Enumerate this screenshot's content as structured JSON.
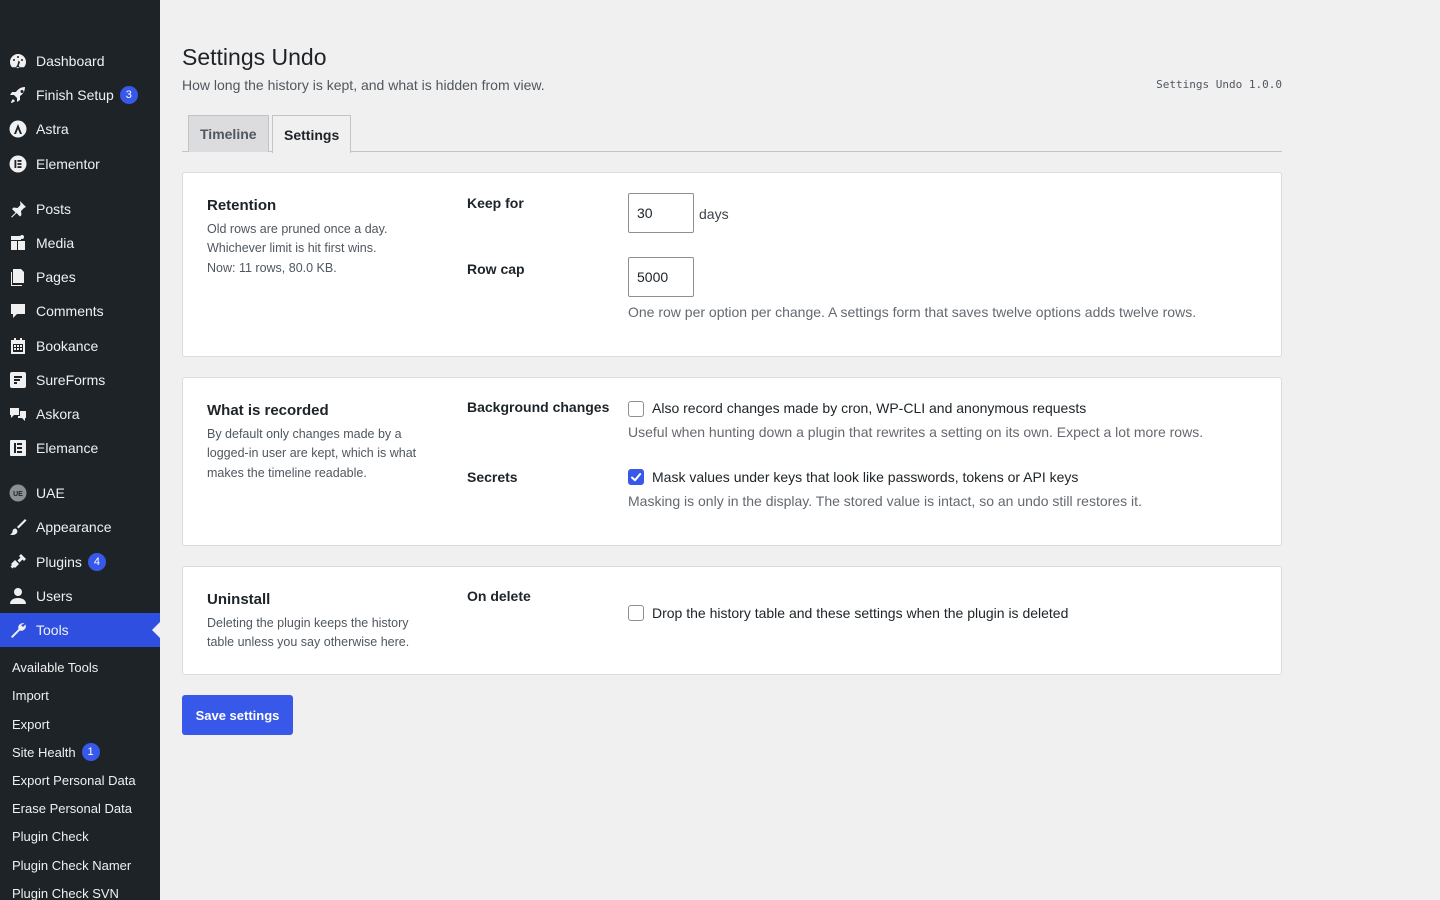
{
  "sidebar": {
    "items": [
      {
        "label": "Dashboard",
        "icon": "dashboard-icon"
      },
      {
        "label": "Finish Setup",
        "icon": "rocket-icon",
        "badge": "3"
      },
      {
        "label": "Astra",
        "icon": "astra-icon"
      },
      {
        "label": "Elementor",
        "icon": "elementor-icon"
      },
      {
        "label": "Posts",
        "icon": "pin-icon"
      },
      {
        "label": "Media",
        "icon": "media-icon"
      },
      {
        "label": "Pages",
        "icon": "pages-icon"
      },
      {
        "label": "Comments",
        "icon": "comment-icon"
      },
      {
        "label": "Bookance",
        "icon": "calendar-icon"
      },
      {
        "label": "SureForms",
        "icon": "sureforms-icon"
      },
      {
        "label": "Askora",
        "icon": "askora-icon"
      },
      {
        "label": "Elemance",
        "icon": "elemance-icon"
      },
      {
        "label": "UAE",
        "icon": "uae-icon"
      },
      {
        "label": "Appearance",
        "icon": "brush-icon"
      },
      {
        "label": "Plugins",
        "icon": "plug-icon",
        "badge": "4"
      },
      {
        "label": "Users",
        "icon": "user-icon"
      },
      {
        "label": "Tools",
        "icon": "wrench-icon",
        "active": true
      }
    ],
    "submenu": [
      {
        "label": "Available Tools"
      },
      {
        "label": "Import"
      },
      {
        "label": "Export"
      },
      {
        "label": "Site Health",
        "badge": "1"
      },
      {
        "label": "Export Personal Data"
      },
      {
        "label": "Erase Personal Data"
      },
      {
        "label": "Plugin Check"
      },
      {
        "label": "Plugin Check Namer"
      },
      {
        "label": "Plugin Check SVN"
      }
    ]
  },
  "header": {
    "title": "Settings Undo",
    "subtitle": "How long the history is kept, and what is hidden from view.",
    "version": "Settings Undo 1.0.0"
  },
  "tabs": {
    "timeline": "Timeline",
    "settings": "Settings"
  },
  "retention": {
    "title": "Retention",
    "desc1": "Old rows are pruned once a day.",
    "desc2": "Whichever limit is hit first wins.",
    "desc3": "Now: 11 rows, 80.0 KB.",
    "keep_label": "Keep for",
    "keep_value": "30",
    "keep_unit": "days",
    "cap_label": "Row cap",
    "cap_value": "5000",
    "cap_help": "One row per option per change. A settings form that saves twelve options adds twelve rows."
  },
  "recorded": {
    "title": "What is recorded",
    "desc1": "By default only changes made by a",
    "desc2": "logged-in user are kept, which is what",
    "desc3": "makes the timeline readable.",
    "bg_label": "Background changes",
    "bg_checked": false,
    "bg_text": "Also record changes made by cron, WP-CLI and anonymous requests",
    "bg_help": "Useful when hunting down a plugin that rewrites a setting on its own. Expect a lot more rows.",
    "secrets_label": "Secrets",
    "secrets_checked": true,
    "secrets_text": "Mask values under keys that look like passwords, tokens or API keys",
    "secrets_help": "Masking is only in the display. The stored value is intact, so an undo still restores it."
  },
  "uninstall": {
    "title": "Uninstall",
    "desc1": "Deleting the plugin keeps the history",
    "desc2": "table unless you say otherwise here.",
    "delete_label": "On delete",
    "delete_checked": false,
    "delete_text": "Drop the history table and these settings when the plugin is deleted"
  },
  "actions": {
    "save_label": "Save settings"
  },
  "colors": {
    "sidebar_bg": "#1d2327",
    "accent": "#3858e9",
    "page_bg": "#f0f0f1"
  }
}
